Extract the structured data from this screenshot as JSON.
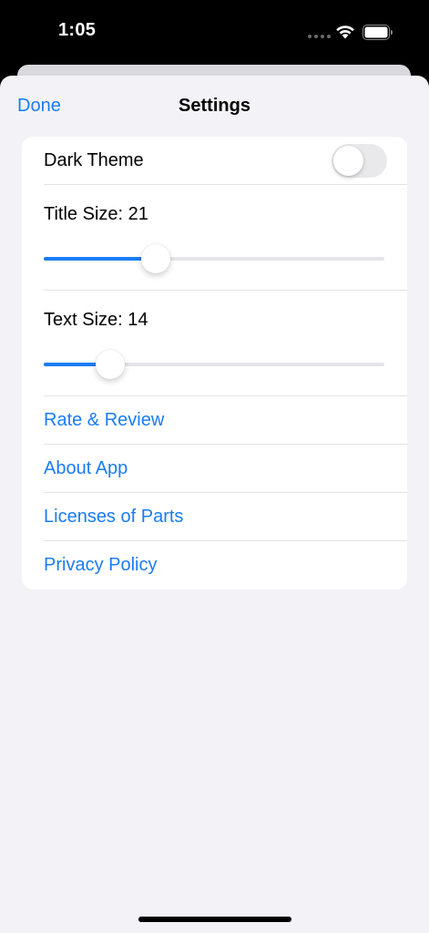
{
  "status_bar": {
    "time": "1:05",
    "icons": [
      "signal-dots-icon",
      "wifi-icon",
      "battery-icon"
    ]
  },
  "nav": {
    "done_label": "Done",
    "title": "Settings"
  },
  "settings": {
    "dark_theme": {
      "label": "Dark Theme",
      "on": false
    },
    "title_size": {
      "label": "Title Size: 21",
      "value": 21,
      "fraction": 0.33
    },
    "text_size": {
      "label": "Text Size: 14",
      "value": 14,
      "fraction": 0.195
    }
  },
  "links": [
    {
      "label": "Rate & Review"
    },
    {
      "label": "About App"
    },
    {
      "label": "Licenses of Parts"
    },
    {
      "label": "Privacy Policy"
    }
  ],
  "colors": {
    "accent": "#1a7cf5",
    "background": "#f2f2f7",
    "card": "#ffffff",
    "toggle_off": "#e9e9eb"
  }
}
